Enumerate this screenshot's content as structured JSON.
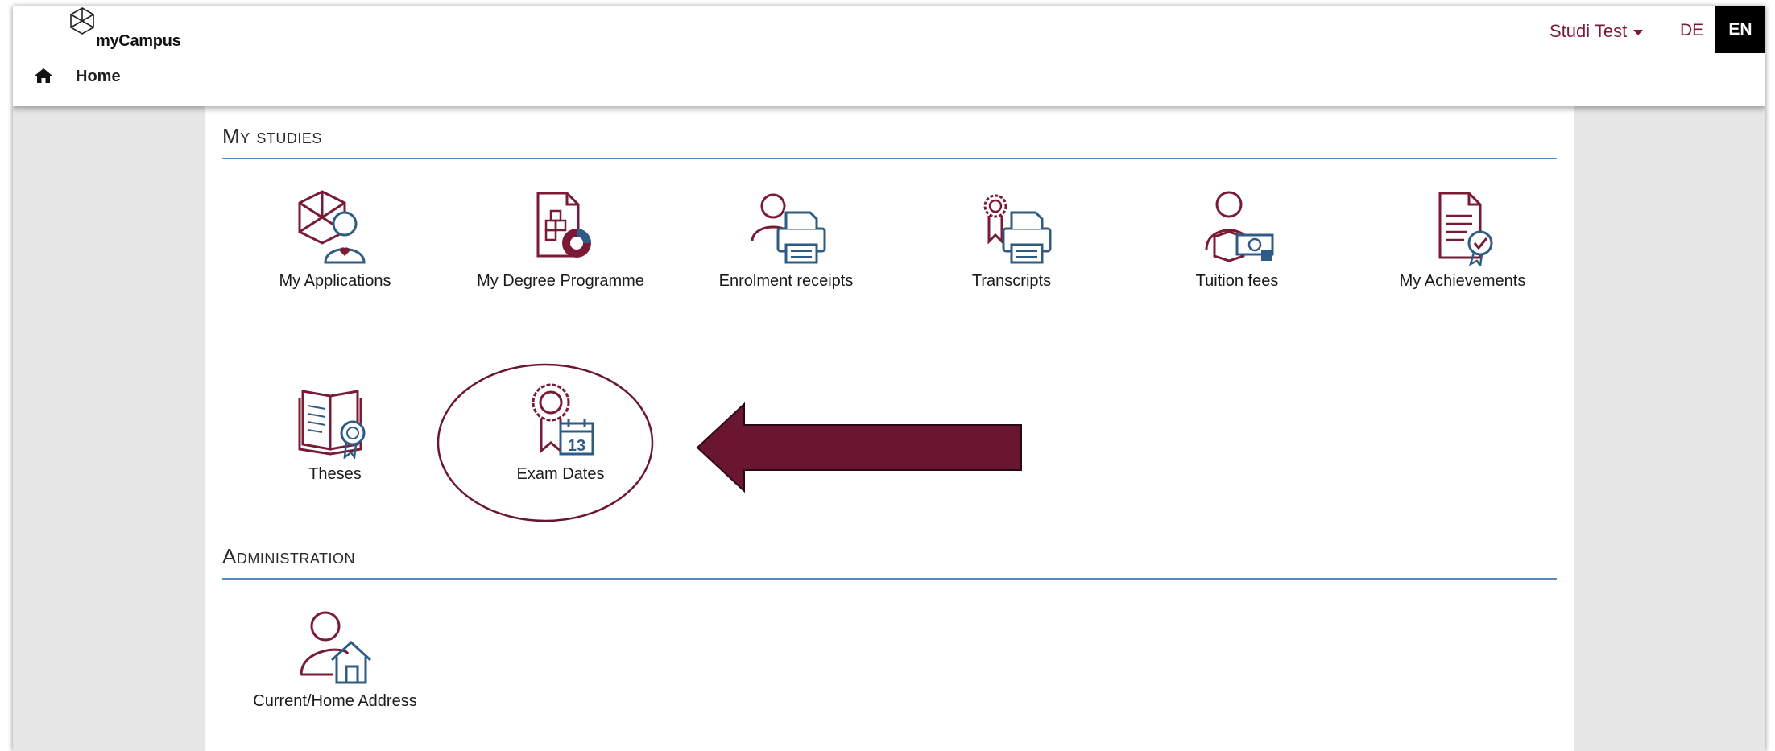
{
  "header": {
    "logo_text": "myCampus",
    "breadcrumb_home": "Home",
    "user_name": "Studi Test",
    "languages": [
      "DE",
      "EN"
    ],
    "active_language": "EN"
  },
  "sections": {
    "studies": {
      "title": "My studies",
      "tiles": [
        {
          "label": "My Applications",
          "icon": "applications-icon"
        },
        {
          "label": "My Degree Programme",
          "icon": "degree-programme-icon"
        },
        {
          "label": "Enrolment receipts",
          "icon": "enrolment-receipts-icon"
        },
        {
          "label": "Transcripts",
          "icon": "transcripts-icon"
        },
        {
          "label": "Tuition fees",
          "icon": "tuition-fees-icon"
        },
        {
          "label": "My Achievements",
          "icon": "achievements-icon"
        },
        {
          "label": "Theses",
          "icon": "theses-icon"
        },
        {
          "label": "Exam Dates",
          "icon": "exam-dates-icon"
        }
      ]
    },
    "administration": {
      "title": "Administration",
      "tiles": [
        {
          "label": "Current/Home Address",
          "icon": "home-address-icon"
        }
      ]
    }
  },
  "annotation": {
    "highlighted_tile": "Exam Dates",
    "arrow_color": "#6b1630"
  },
  "colors": {
    "accent": "#7a1a34",
    "icon_blue": "#2d5b86",
    "rule_blue": "#5b87c5"
  }
}
